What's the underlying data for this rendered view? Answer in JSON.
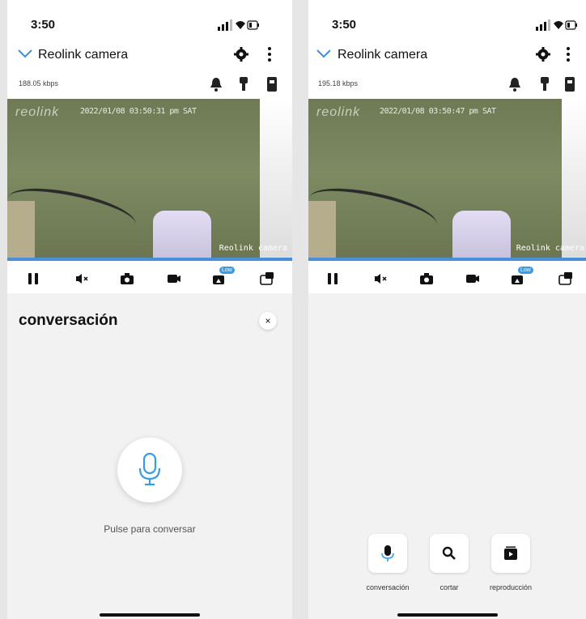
{
  "left": {
    "status_time": "3:50",
    "title": "Reolink camera",
    "bitrate": "188.05 kbps",
    "osd_time": "2022/01/08 03:50:31 pm SAT",
    "osd_name": "Reolink camera",
    "logo": "reolink",
    "quality_badge": "Low",
    "panel_title": "conversación",
    "close_glyph": "×",
    "mic_label": "Pulse para conversar"
  },
  "right": {
    "status_time": "3:50",
    "title": "Reolink camera",
    "bitrate": "195.18 kbps",
    "osd_time": "2022/01/08 03:50:47 pm SAT",
    "osd_name": "Reolink camera",
    "logo": "reolink",
    "quality_badge": "Low",
    "actions": [
      {
        "label": "conversación",
        "icon": "microphone-icon"
      },
      {
        "label": "cortar",
        "icon": "search-icon"
      },
      {
        "label": "reproducción",
        "icon": "playback-icon"
      }
    ]
  },
  "colors": {
    "accent": "#4a90d9",
    "mic_blue": "#3b9be0"
  }
}
